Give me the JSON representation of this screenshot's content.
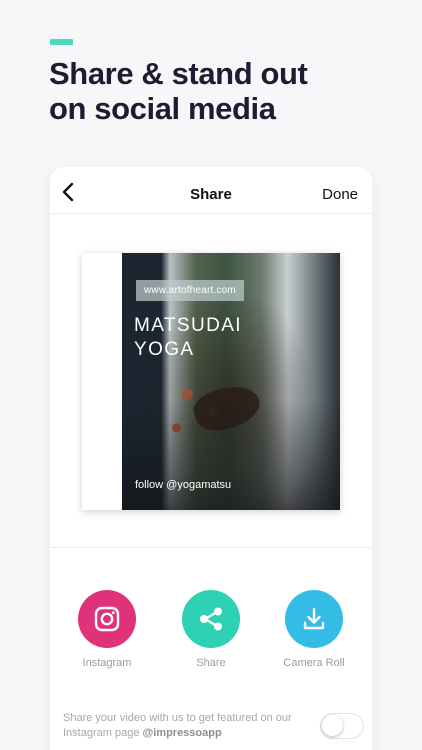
{
  "headline": {
    "line1": "Share & stand out",
    "line2": "on social media"
  },
  "navbar": {
    "title": "Share",
    "done_label": "Done",
    "back_icon": "chevron-left-icon"
  },
  "preview": {
    "url": "www.artofheart.com",
    "brand_line1": "MATSUDAI",
    "brand_line2": "YOGA",
    "follow": "follow @yogamatsu"
  },
  "actions": [
    {
      "label": "Instagram",
      "icon": "instagram-icon",
      "color": "#e0327b"
    },
    {
      "label": "Share",
      "icon": "share-icon",
      "color": "#2fd1b4"
    },
    {
      "label": "Camera Roll",
      "icon": "download-icon",
      "color": "#33bde6"
    }
  ],
  "featured": {
    "text": "Share your video with us to get featured on our Instagram page",
    "handle": "@impressoapp",
    "toggle_on": false
  },
  "colors": {
    "accent": "#4dd8c4",
    "background": "#f7f7f9"
  }
}
